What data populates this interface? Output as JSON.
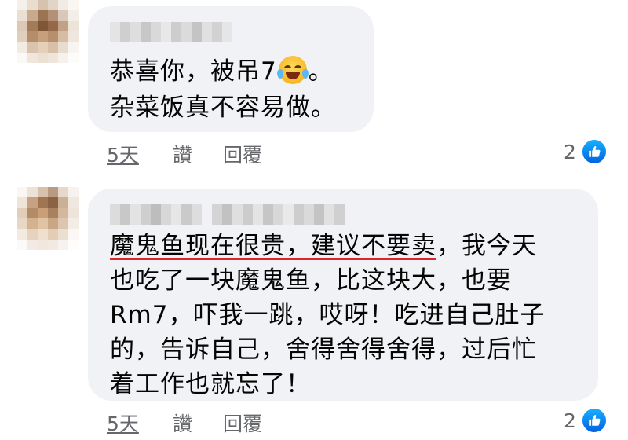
{
  "comments": [
    {
      "lines": [
        "恭喜你，被吊7",
        "。",
        "杂菜饭真不容易做。"
      ],
      "emoji": "face-with-tears-of-joy-icon",
      "time": "5天",
      "like": "讚",
      "reply": "回覆",
      "reaction_count": "2"
    },
    {
      "underlined": "魔鬼鱼现在很贵，建议不要卖",
      "line1_rest": "，我今天",
      "lines": [
        "也吃了一块魔鬼鱼，比这块大，也要",
        "Rm7，吓我一跳，哎呀！吃进自己肚子",
        "的，告诉自己，舍得舍得舍得，过后忙",
        "着工作也就忘了！"
      ],
      "time": "5天",
      "like": "讚",
      "reply": "回覆",
      "reaction_count": "2"
    }
  ],
  "colors": {
    "bubble": "#f0f2f5",
    "meta_text": "#65676b",
    "like_blue": "#1877f2",
    "underline_red": "#e0242a"
  }
}
